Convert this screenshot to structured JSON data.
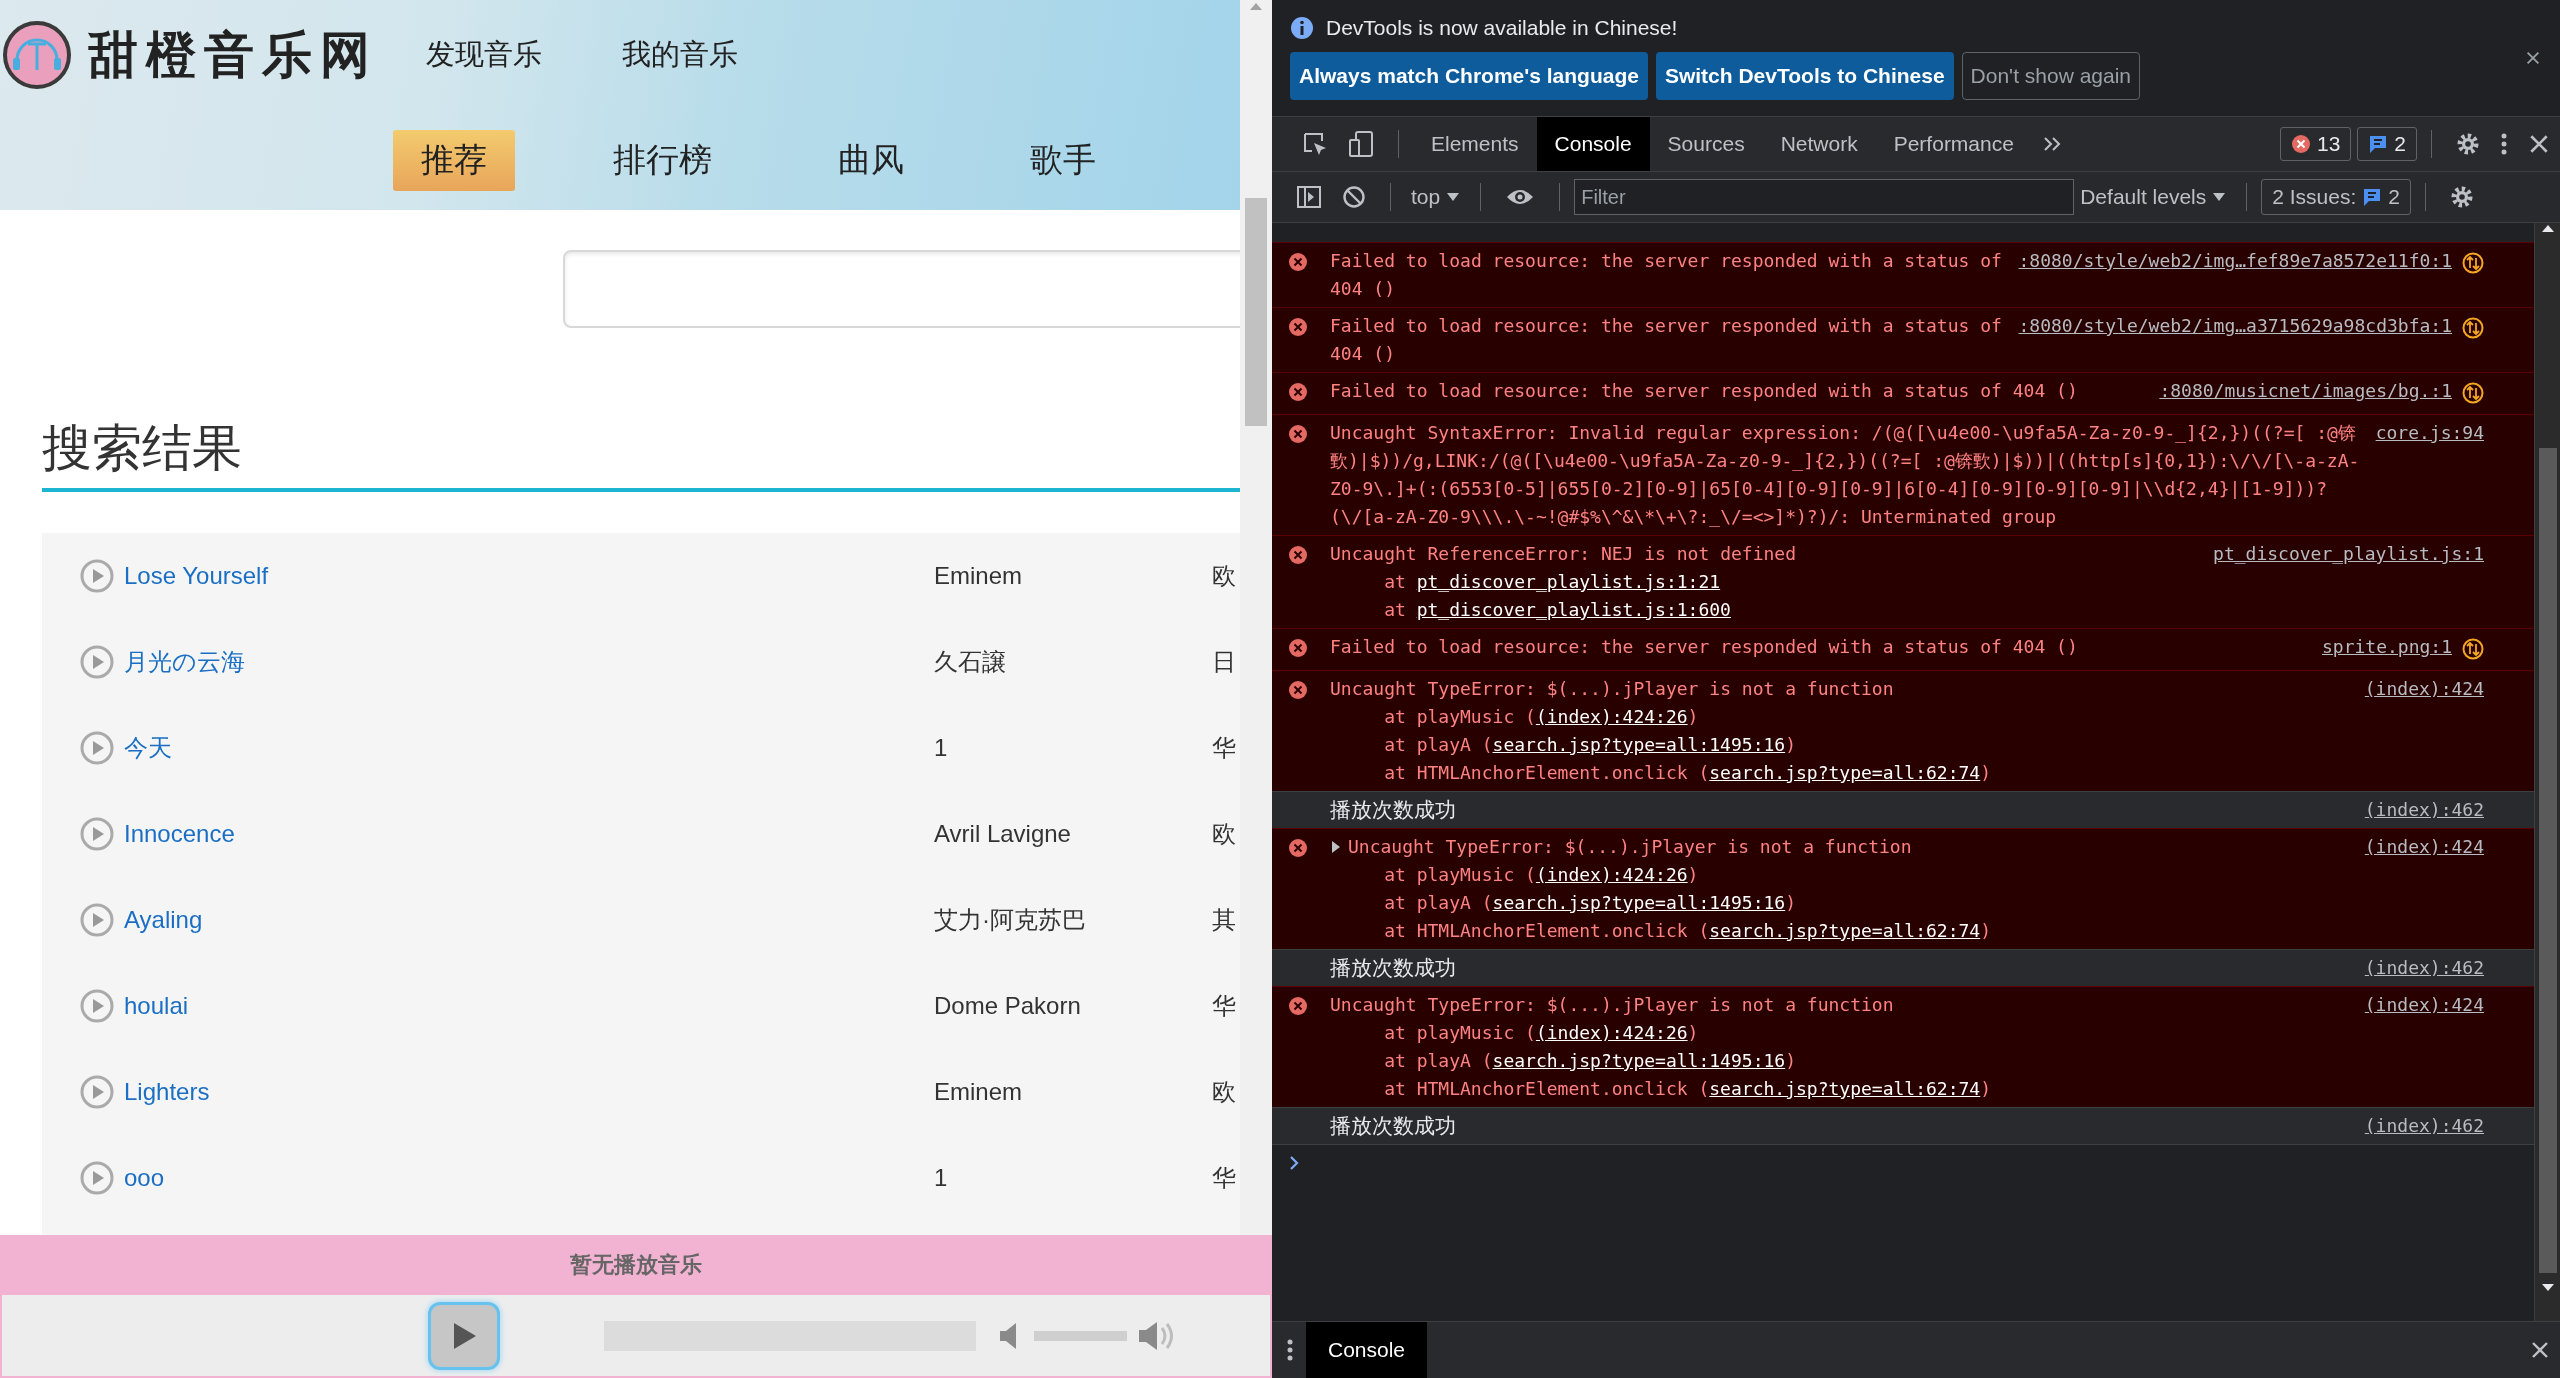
{
  "page": {
    "logo": {
      "text": "甜橙音乐网"
    },
    "top_nav": [
      {
        "label": "发现音乐"
      },
      {
        "label": "我的音乐"
      }
    ],
    "tabs": [
      {
        "label": "推荐",
        "selected": true
      },
      {
        "label": "排行榜",
        "selected": false
      },
      {
        "label": "曲风",
        "selected": false
      },
      {
        "label": "歌手",
        "selected": false
      }
    ],
    "heading": "搜索结果",
    "results": [
      {
        "title": "Lose Yourself",
        "artist": "Eminem",
        "column_3": "欧"
      },
      {
        "title": "月光の云海",
        "artist": "久石譲",
        "column_3": "日"
      },
      {
        "title": "今天",
        "artist": "1",
        "column_3": "华"
      },
      {
        "title": "Innocence",
        "artist": "Avril Lavigne",
        "column_3": "欧"
      },
      {
        "title": "Ayaling",
        "artist": "艾力·阿克苏巴",
        "column_3": "其"
      },
      {
        "title": "houlai",
        "artist": "Dome Pakorn",
        "column_3": "华"
      },
      {
        "title": "Lighters",
        "artist": "Eminem",
        "column_3": "欧"
      },
      {
        "title": "ooo",
        "artist": "1",
        "column_3": "华"
      }
    ],
    "player": {
      "status": "暂无播放音乐",
      "progress": {
        "level": 0
      },
      "volume": {
        "level": 1
      }
    }
  },
  "devtools": {
    "infobar": {
      "message": "DevTools is now available in Chinese!",
      "buttons": [
        {
          "label": "Always match Chrome's language",
          "kind": "primary"
        },
        {
          "label": "Switch DevTools to Chinese",
          "kind": "primary"
        },
        {
          "label": "Don't show again",
          "kind": "outline"
        }
      ]
    },
    "tabs": [
      {
        "label": "Elements",
        "selected": false
      },
      {
        "label": "Console",
        "selected": true
      },
      {
        "label": "Sources",
        "selected": false
      },
      {
        "label": "Network",
        "selected": false
      },
      {
        "label": "Performance",
        "selected": false
      }
    ],
    "error_count": "13",
    "message_count": "2",
    "toolbar": {
      "context": "top",
      "filter_placeholder": "Filter",
      "levels": "Default levels",
      "issues_label": "2 Issues:",
      "issues_count": "2"
    },
    "messages": [
      {
        "kind": "error",
        "text": "Failed to load resource: the server responded with a status of 404 ()",
        "source": ":8080/style/web2/img…fef89e7a8572e11f0:1",
        "network": true,
        "expandable": false
      },
      {
        "kind": "error",
        "text": "Failed to load resource: the server responded with a status of 404 ()",
        "source": ":8080/style/web2/img…a3715629a98cd3bfa:1",
        "network": true,
        "expandable": false
      },
      {
        "kind": "error",
        "text": "Failed to load resource: the server responded with a status of 404 ()",
        "source": ":8080/musicnet/images/bg.:1",
        "network": true,
        "expandable": false
      },
      {
        "kind": "error",
        "text": "Uncaught SyntaxError: Invalid regular expression: /(@([\\u4e00-\\u9fa5A-Za-z0-9-_]{2,})((?=[ :@锛歅)|$))/g,LINK:/(@([\\u4e00-\\u9fa5A-Za-z0-9-_]{2,})((?=[ :@锛歅)|$))|((http[s]{0,1}):\\/\\/[\\-a-zA-Z0-9\\.]+(:(6553[0-5]|655[0-2][0-9]|65[0-4][0-9][0-9]|6[0-4][0-9][0-9][0-9]|\\\\d{2,4}|[1-9]))?(\\/[a-zA-Z0-9\\\\\\.\\-~!@#$%\\^&\\*\\+\\?:_\\/=<>]*)?)/: Unterminated group",
        "source": "core.js:94",
        "network": false,
        "expandable": false
      },
      {
        "kind": "error",
        "text": "Uncaught ReferenceError: NEJ is not defined",
        "source": "pt_discover_playlist.js:1",
        "network": false,
        "expandable": false,
        "stack": [
          {
            "prefix": "at ",
            "link": "pt_discover_playlist.js:1:21"
          },
          {
            "prefix": "at ",
            "link": "pt_discover_playlist.js:1:600"
          }
        ]
      },
      {
        "kind": "error",
        "text": "Failed to load resource: the server responded with a status of 404 ()",
        "source": "sprite.png:1",
        "network": true,
        "expandable": false
      },
      {
        "kind": "error",
        "text": "Uncaught TypeError: $(...).jPlayer is not a function",
        "source": "(index):424",
        "network": false,
        "expandable": false,
        "stack": [
          {
            "prefix": "at playMusic (",
            "link": "(index):424:26",
            "suffix": ")"
          },
          {
            "prefix": "at playA (",
            "link": "search.jsp?type=all:1495:16",
            "suffix": ")"
          },
          {
            "prefix": "at HTMLAnchorElement.onclick (",
            "link": "search.jsp?type=all:62:74",
            "suffix": ")"
          }
        ]
      },
      {
        "kind": "info",
        "text": "播放次数成功",
        "source": "(index):462"
      },
      {
        "kind": "error",
        "text": "Uncaught TypeError: $(...).jPlayer is not a function",
        "source": "(index):424",
        "network": false,
        "expandable": true,
        "stack": [
          {
            "prefix": "at playMusic (",
            "link": "(index):424:26",
            "suffix": ")"
          },
          {
            "prefix": "at playA (",
            "link": "search.jsp?type=all:1495:16",
            "suffix": ")"
          },
          {
            "prefix": "at HTMLAnchorElement.onclick (",
            "link": "search.jsp?type=all:62:74",
            "suffix": ")"
          }
        ]
      },
      {
        "kind": "info",
        "text": "播放次数成功",
        "source": "(index):462"
      },
      {
        "kind": "error",
        "text": "Uncaught TypeError: $(...).jPlayer is not a function",
        "source": "(index):424",
        "network": false,
        "expandable": false,
        "stack": [
          {
            "prefix": "at playMusic (",
            "link": "(index):424:26",
            "suffix": ")"
          },
          {
            "prefix": "at playA (",
            "link": "search.jsp?type=all:1495:16",
            "suffix": ")"
          },
          {
            "prefix": "at HTMLAnchorElement.onclick (",
            "link": "search.jsp?type=all:62:74",
            "suffix": ")"
          }
        ]
      },
      {
        "kind": "info",
        "text": "播放次数成功",
        "source": "(index):462"
      }
    ],
    "drawer": {
      "tabs": [
        {
          "label": "Console",
          "selected": true
        }
      ]
    }
  }
}
